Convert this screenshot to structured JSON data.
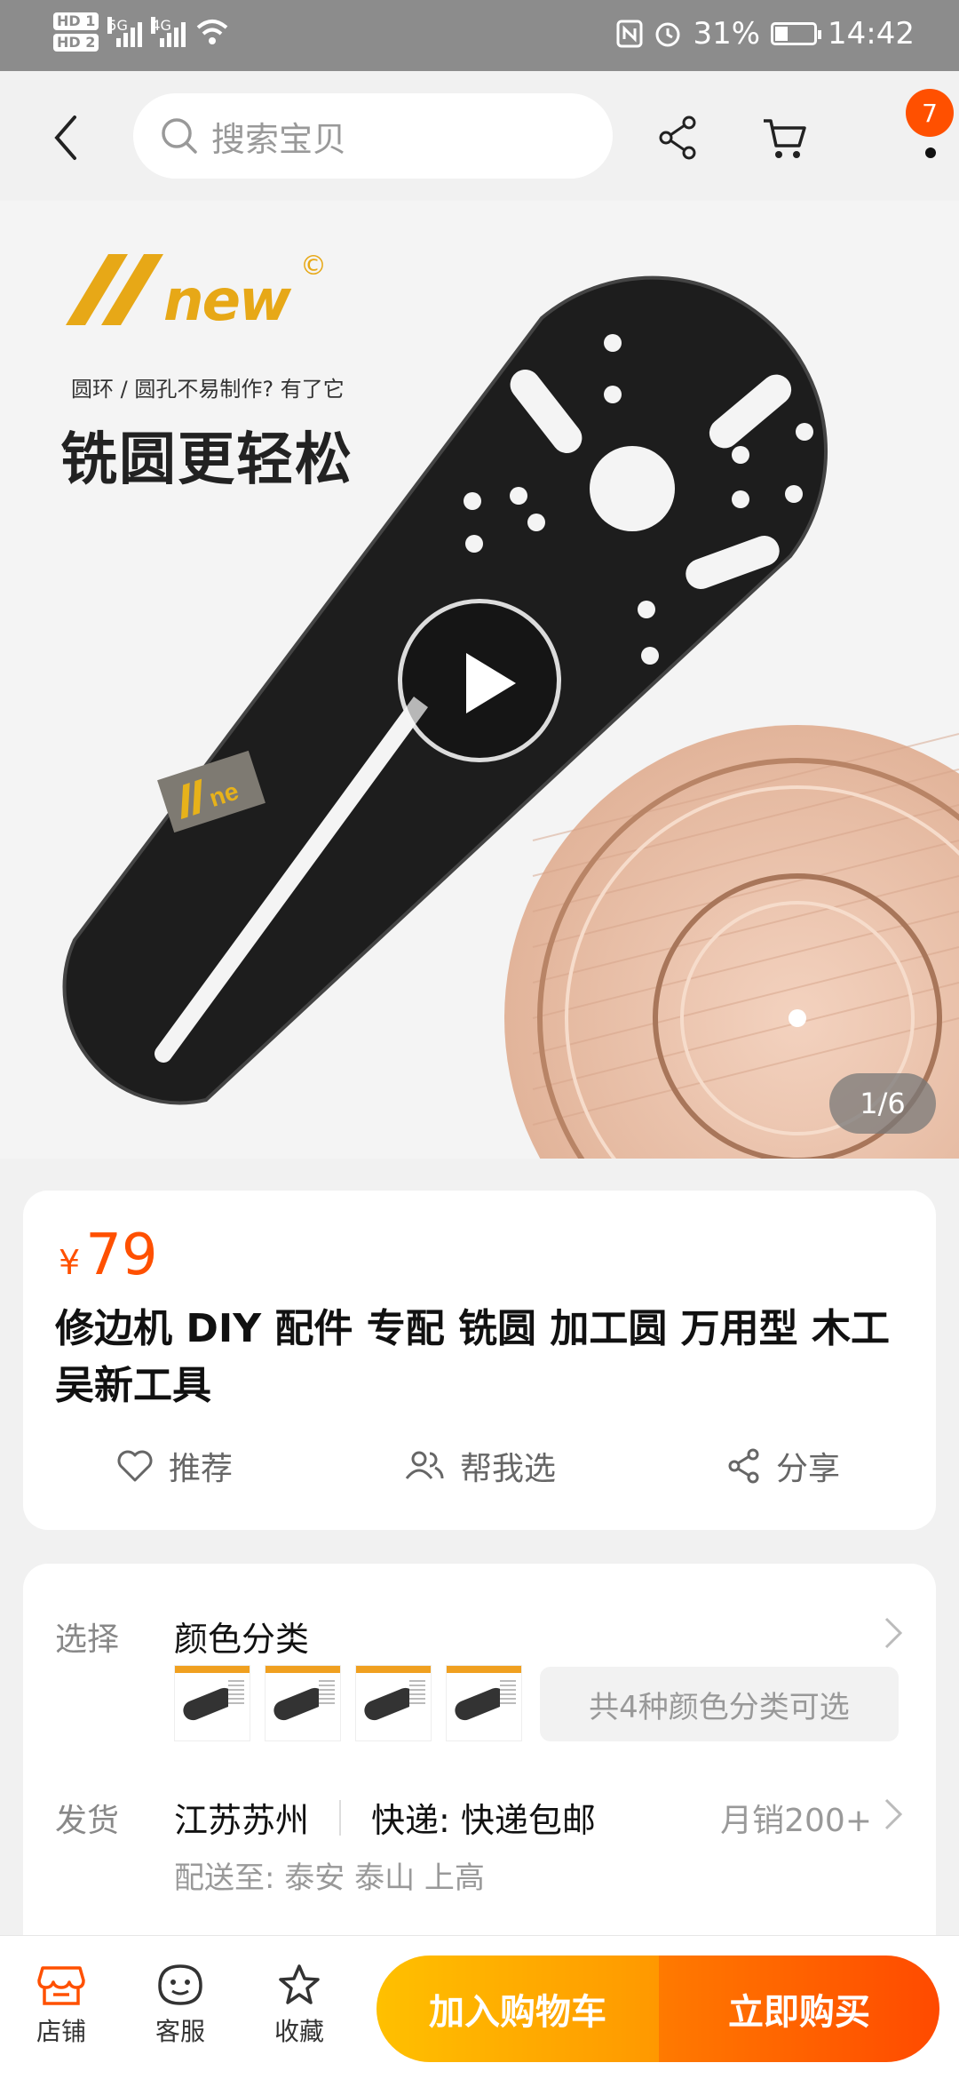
{
  "status_bar": {
    "hd1": "HD 1",
    "hd2": "HD 2",
    "net1": "5G",
    "net2": "4G",
    "battery_pct": "31%",
    "time": "14:42",
    "battery_level": 0.31
  },
  "nav": {
    "search_placeholder": "搜索宝贝",
    "cart_badge": "7"
  },
  "hero": {
    "brand": "new",
    "copyright": "©",
    "tagline": "圆环 / 圆孔不易制作? 有了它",
    "headline": "铣圆更轻松",
    "image_counter": "1/6"
  },
  "product": {
    "currency": "¥",
    "price": "79",
    "title": "修边机 DIY 配件 专配 铣圆  加工圆 万用型 木工 吴新工具",
    "actions": {
      "recommend": "推荐",
      "help_choose": "帮我选",
      "share": "分享"
    }
  },
  "options": {
    "select_label": "选择",
    "select_title": "颜色分类",
    "variant_note": "共4种颜色分类可选",
    "ship_label": "发货",
    "origin": "江苏苏州",
    "express": "快递: 快递包邮",
    "monthly_sales": "月销200+",
    "deliver_to": "配送至: 泰安 泰山 上高"
  },
  "bottom_bar": {
    "store": "店铺",
    "service": "客服",
    "favorite": "收藏",
    "add_to_cart": "加入购物车",
    "buy_now": "立即购买"
  },
  "colors": {
    "accent": "#ff5000",
    "cart_button": "#ffb000",
    "buy_button": "#ff5a00"
  },
  "icons": [
    "back-arrow-icon",
    "search-icon",
    "share-icon",
    "cart-icon",
    "play-icon",
    "heart-icon",
    "people-icon",
    "share-icon",
    "chevron-right-icon",
    "store-icon",
    "service-icon",
    "star-icon"
  ]
}
